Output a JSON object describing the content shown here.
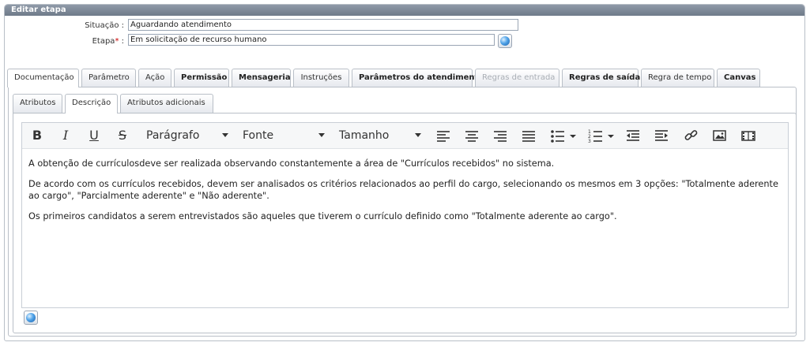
{
  "panel": {
    "title": "Editar etapa"
  },
  "form": {
    "situacao_label": "Situação :",
    "situacao_value": "Aguardando atendimento",
    "etapa_label": "Etapa",
    "etapa_required": "*",
    "etapa_colon": " :",
    "etapa_value": "Em solicitação de  recurso humano"
  },
  "tabs": [
    {
      "label": "Documentação",
      "state": "active"
    },
    {
      "label": "Parâmetro",
      "state": "normal"
    },
    {
      "label": "Ação",
      "state": "normal"
    },
    {
      "label": "Permissão",
      "state": "bold"
    },
    {
      "label": "Mensageria",
      "state": "bold"
    },
    {
      "label": "Instruções",
      "state": "normal"
    },
    {
      "label": "Parâmetros do atendimento",
      "state": "bold"
    },
    {
      "label": "Regras de entrada",
      "state": "disabled"
    },
    {
      "label": "Regras de saída",
      "state": "bold"
    },
    {
      "label": "Regra de tempo",
      "state": "normal"
    },
    {
      "label": "Canvas",
      "state": "bold"
    }
  ],
  "subtabs": [
    {
      "label": "Atributos",
      "state": "normal"
    },
    {
      "label": "Descrição",
      "state": "active"
    },
    {
      "label": "Atributos adicionais",
      "state": "normal"
    }
  ],
  "toolbar": {
    "bold": "B",
    "italic": "I",
    "underline": "U",
    "strike": "S",
    "paragraph": "Parágrafo",
    "font": "Fonte",
    "size": "Tamanho",
    "icons": [
      "align-left-icon",
      "align-center-icon",
      "align-right-icon",
      "justify-icon",
      "bullet-list-icon",
      "numbered-list-icon",
      "outdent-icon",
      "indent-icon",
      "link-icon",
      "image-icon",
      "video-icon"
    ]
  },
  "editor": {
    "paragraphs": [
      "A obtenção de currículosdeve ser realizada observando constantemente a área de \"Currículos recebidos\" no sistema.",
      "De acordo com os currículos recebidos, devem ser analisados os critérios relacionados ao perfil do cargo, selecionando os mesmos em 3 opções: \"Totalmente aderente ao cargo\", \"Parcialmente aderente\" e \"Não aderente\".",
      "Os primeiros candidatos a serem entrevistados são aqueles que tiverem o currículo definido como \"Totalmente aderente ao cargo\"."
    ]
  }
}
